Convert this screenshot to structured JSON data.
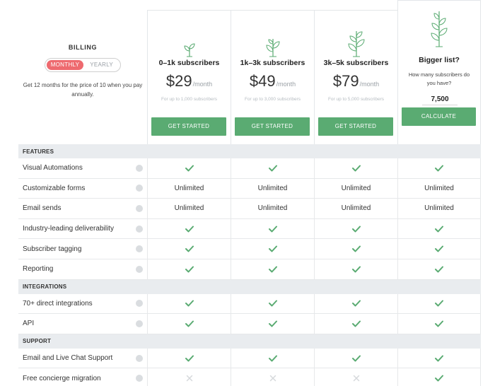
{
  "billing": {
    "title": "BILLING",
    "toggle_active": "MONTHLY",
    "toggle_inactive": "YEARLY",
    "note": "Get 12 months for the price of 10 when you pay annually.",
    "accent_color": "#ee6a6f"
  },
  "plans": [
    {
      "name": "0–1k subscribers",
      "price": "$29",
      "per": "/month",
      "sub": "For up to 1,000 subscribers",
      "button": "GET STARTED",
      "icon": "sprout-small-icon"
    },
    {
      "name": "1k–3k subscribers",
      "price": "$49",
      "per": "/month",
      "sub": "For up to 3,000 subscribers",
      "button": "GET STARTED",
      "icon": "sprout-medium-icon"
    },
    {
      "name": "3k–5k subscribers",
      "price": "$79",
      "per": "/month",
      "sub": "For up to 5,000 subscribers",
      "button": "GET STARTED",
      "icon": "sprout-large-icon"
    }
  ],
  "bigger": {
    "title": "Bigger list?",
    "question": "How many subscribers do you have?",
    "value": "7,500",
    "button": "CALCULATE",
    "icon": "plant-icon"
  },
  "button_color": "#5aab72",
  "sections": [
    {
      "label": "FEATURES",
      "rows": [
        {
          "label": "Visual Automations",
          "cells": [
            "check",
            "check",
            "check",
            "check"
          ]
        },
        {
          "label": "Customizable forms",
          "cells": [
            "Unlimited",
            "Unlimited",
            "Unlimited",
            "Unlimited"
          ]
        },
        {
          "label": "Email sends",
          "cells": [
            "Unlimited",
            "Unlimited",
            "Unlimited",
            "Unlimited"
          ]
        },
        {
          "label": "Industry-leading deliverability",
          "cells": [
            "check",
            "check",
            "check",
            "check"
          ]
        },
        {
          "label": "Subscriber tagging",
          "cells": [
            "check",
            "check",
            "check",
            "check"
          ]
        },
        {
          "label": "Reporting",
          "cells": [
            "check",
            "check",
            "check",
            "check"
          ]
        }
      ]
    },
    {
      "label": "INTEGRATIONS",
      "rows": [
        {
          "label": "70+ direct integrations",
          "cells": [
            "check",
            "check",
            "check",
            "check"
          ]
        },
        {
          "label": "API",
          "cells": [
            "check",
            "check",
            "check",
            "check"
          ]
        }
      ]
    },
    {
      "label": "SUPPORT",
      "rows": [
        {
          "label": "Email and Live Chat Support",
          "cells": [
            "check",
            "check",
            "check",
            "check"
          ]
        },
        {
          "label": "Free concierge migration",
          "cells": [
            "cross",
            "cross",
            "cross",
            "check"
          ]
        }
      ]
    }
  ]
}
